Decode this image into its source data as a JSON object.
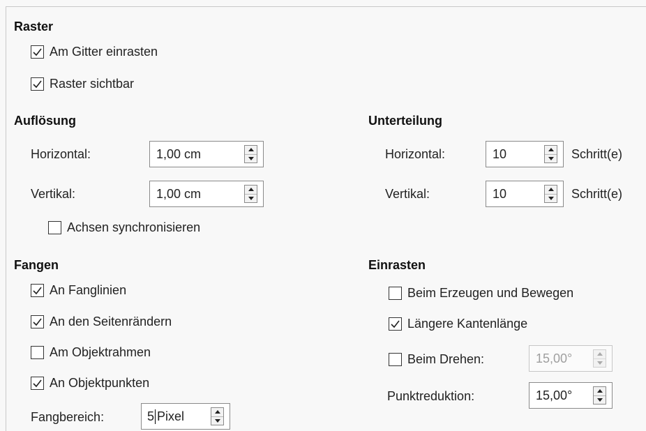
{
  "raster": {
    "title": "Raster",
    "snap_to_grid": {
      "label": "Am Gitter einrasten",
      "checked": true
    },
    "visible_grid": {
      "label": "Raster sichtbar",
      "checked": true
    }
  },
  "resolution": {
    "title": "Auflösung",
    "horizontal_label": "Horizontal:",
    "horizontal_value": "1,00 cm",
    "vertical_label": "Vertikal:",
    "vertical_value": "1,00 cm",
    "sync_axes": {
      "label": "Achsen synchronisieren",
      "checked": false
    }
  },
  "subdivision": {
    "title": "Unterteilung",
    "horizontal_label": "Horizontal:",
    "horizontal_value": "10",
    "horizontal_unit": "Schritt(e)",
    "vertical_label": "Vertikal:",
    "vertical_value": "10",
    "vertical_unit": "Schritt(e)"
  },
  "snap": {
    "title": "Fangen",
    "snap_lines": {
      "label": "An Fanglinien",
      "checked": true
    },
    "page_margins": {
      "label": "An den Seitenrändern",
      "checked": true
    },
    "object_frame": {
      "label": "Am Objektrahmen",
      "checked": false
    },
    "object_points": {
      "label": "An Objektpunkten",
      "checked": true
    },
    "snap_range_label": "Fangbereich:",
    "snap_range_value": "5",
    "snap_range_unit": "Pixel"
  },
  "constrain": {
    "title": "Einrasten",
    "when_creating": {
      "label": "Beim Erzeugen und Bewegen",
      "checked": false
    },
    "extend_edges": {
      "label": "Längere Kantenlänge",
      "checked": true
    },
    "when_rotating": {
      "label": "Beim Drehen:",
      "checked": false
    },
    "rotating_value": "15,00°",
    "point_reduction_label": "Punktreduktion:",
    "point_reduction_value": "15,00°"
  }
}
